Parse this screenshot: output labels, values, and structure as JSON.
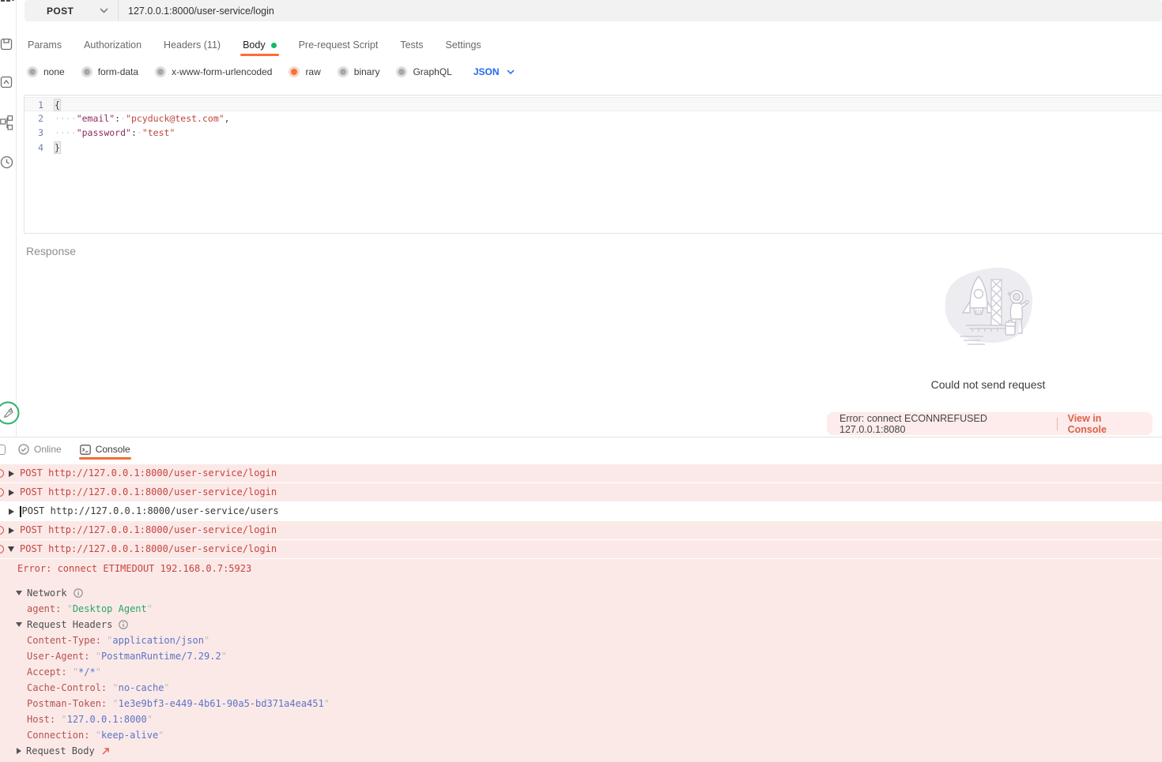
{
  "colors": {
    "accent_orange": "#ff6c37",
    "link_blue": "#2567f2",
    "error_red": "#c4453f",
    "error_pink_bg": "#fbe9e8",
    "body_dot_green": "#16b96a",
    "value_green": "#27a867",
    "value_blue": "#5b74c4",
    "agent_icon_green": "#2bb169"
  },
  "request_bar": {
    "method": "POST",
    "url": "127.0.0.1:8000/user-service/login"
  },
  "tabs": [
    {
      "label": "Params",
      "active": false,
      "dot": false
    },
    {
      "label": "Authorization",
      "active": false,
      "dot": false
    },
    {
      "label": "Headers (11)",
      "active": false,
      "dot": false
    },
    {
      "label": "Body",
      "active": true,
      "dot": true
    },
    {
      "label": "Pre-request Script",
      "active": false,
      "dot": false
    },
    {
      "label": "Tests",
      "active": false,
      "dot": false
    },
    {
      "label": "Settings",
      "active": false,
      "dot": false
    }
  ],
  "body_types": {
    "options": [
      "none",
      "form-data",
      "x-www-form-urlencoded",
      "raw",
      "binary",
      "GraphQL"
    ],
    "selected": "raw",
    "format_selected": "JSON"
  },
  "editor": {
    "lines": [
      {
        "num": "1",
        "active": true,
        "tokens": [
          {
            "c": "brace",
            "t": "{"
          }
        ]
      },
      {
        "num": "2",
        "active": false,
        "tokens": [
          {
            "c": "ws",
            "t": "····"
          },
          {
            "c": "key",
            "t": "\"email\""
          },
          {
            "c": "punc",
            "t": ":"
          },
          {
            "c": "ws",
            "t": "·"
          },
          {
            "c": "str",
            "t": "\"pcyduck@test.com\""
          },
          {
            "c": "punc",
            "t": ","
          }
        ]
      },
      {
        "num": "3",
        "active": false,
        "tokens": [
          {
            "c": "ws",
            "t": "····"
          },
          {
            "c": "key",
            "t": "\"password\""
          },
          {
            "c": "punc",
            "t": ":"
          },
          {
            "c": "ws",
            "t": "·"
          },
          {
            "c": "str",
            "t": "\"test\""
          }
        ]
      },
      {
        "num": "4",
        "active": false,
        "tokens": [
          {
            "c": "brace",
            "t": "}"
          }
        ]
      }
    ]
  },
  "response": {
    "section_label": "Response",
    "empty_message": "Could not send request",
    "error_text": "Error: connect ECONNREFUSED 127.0.0.1:8080",
    "error_action": "View in Console"
  },
  "status_bar": {
    "online_label": "Online",
    "console_label": "Console"
  },
  "console": {
    "entries": [
      {
        "kind": "error",
        "marker": "right",
        "text": "POST http://127.0.0.1:8000/user-service/login",
        "cursor": false
      },
      {
        "kind": "error",
        "marker": "right",
        "text": "POST http://127.0.0.1:8000/user-service/login",
        "cursor": false
      },
      {
        "kind": "plain",
        "marker": "right",
        "text": "POST http://127.0.0.1:8000/user-service/users",
        "cursor": true
      },
      {
        "kind": "error",
        "marker": "right",
        "text": "POST http://127.0.0.1:8000/user-service/login",
        "cursor": false
      },
      {
        "kind": "error",
        "marker": "down",
        "text": "POST http://127.0.0.1:8000/user-service/login",
        "cursor": false
      }
    ],
    "detail": {
      "error_line": "Error: connect ETIMEDOUT 192.168.0.7:5923",
      "sections": [
        {
          "type": "group",
          "label": "Network",
          "marker": "down",
          "info": true,
          "external": false
        },
        {
          "type": "kv",
          "key": "agent",
          "value": "Desktop Agent",
          "vclass": "green"
        },
        {
          "type": "group",
          "label": "Request Headers",
          "marker": "down",
          "info": true,
          "external": false
        },
        {
          "type": "kv",
          "key": "Content-Type",
          "value": "application/json",
          "vclass": "blue"
        },
        {
          "type": "kv",
          "key": "User-Agent",
          "value": "PostmanRuntime/7.29.2",
          "vclass": "blue"
        },
        {
          "type": "kv",
          "key": "Accept",
          "value": "*/*",
          "vclass": "blue"
        },
        {
          "type": "kv",
          "key": "Cache-Control",
          "value": "no-cache",
          "vclass": "blue"
        },
        {
          "type": "kv",
          "key": "Postman-Token",
          "value": "1e3e9bf3-e449-4b61-90a5-bd371a4ea451",
          "vclass": "blue"
        },
        {
          "type": "kv",
          "key": "Host",
          "value": "127.0.0.1:8000",
          "vclass": "blue"
        },
        {
          "type": "kv",
          "key": "Connection",
          "value": "keep-alive",
          "vclass": "blue"
        },
        {
          "type": "group",
          "label": "Request Body",
          "marker": "right",
          "info": false,
          "external": true
        }
      ]
    }
  }
}
